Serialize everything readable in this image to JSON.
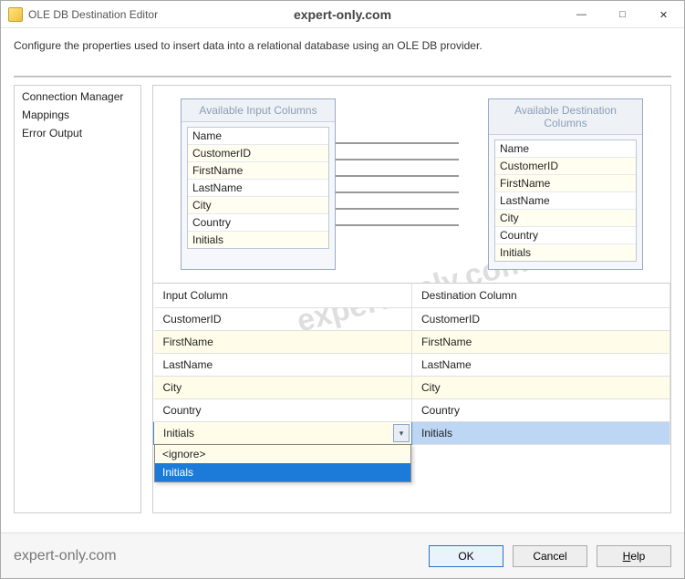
{
  "window": {
    "title": "OLE DB Destination Editor",
    "center_brand": "expert-only.com"
  },
  "instructions": "Configure the properties used to insert data into a relational database using an OLE DB provider.",
  "sidebar": {
    "items": [
      "Connection Manager",
      "Mappings",
      "Error Output"
    ]
  },
  "diagram": {
    "input_header": "Available Input Columns",
    "dest_header": "Available Destination Columns",
    "columns": [
      "Name",
      "CustomerID",
      "FirstName",
      "LastName",
      "City",
      "Country",
      "Initials"
    ]
  },
  "grid": {
    "headers": {
      "input": "Input Column",
      "dest": "Destination Column"
    },
    "rows": [
      {
        "in": "CustomerID",
        "out": "CustomerID",
        "alt": false
      },
      {
        "in": "FirstName",
        "out": "FirstName",
        "alt": true
      },
      {
        "in": "LastName",
        "out": "LastName",
        "alt": false
      },
      {
        "in": "City",
        "out": "City",
        "alt": true
      },
      {
        "in": "Country",
        "out": "Country",
        "alt": false
      },
      {
        "in": "Initials",
        "out": "Initials",
        "alt": true,
        "selected": true
      }
    ],
    "dropdown": {
      "options": [
        "<ignore>",
        "Initials"
      ],
      "active": "Initials"
    }
  },
  "footer": {
    "brand": "expert-only.com",
    "ok": "OK",
    "cancel": "Cancel",
    "help": "Help"
  },
  "watermark": "expert-only.com"
}
